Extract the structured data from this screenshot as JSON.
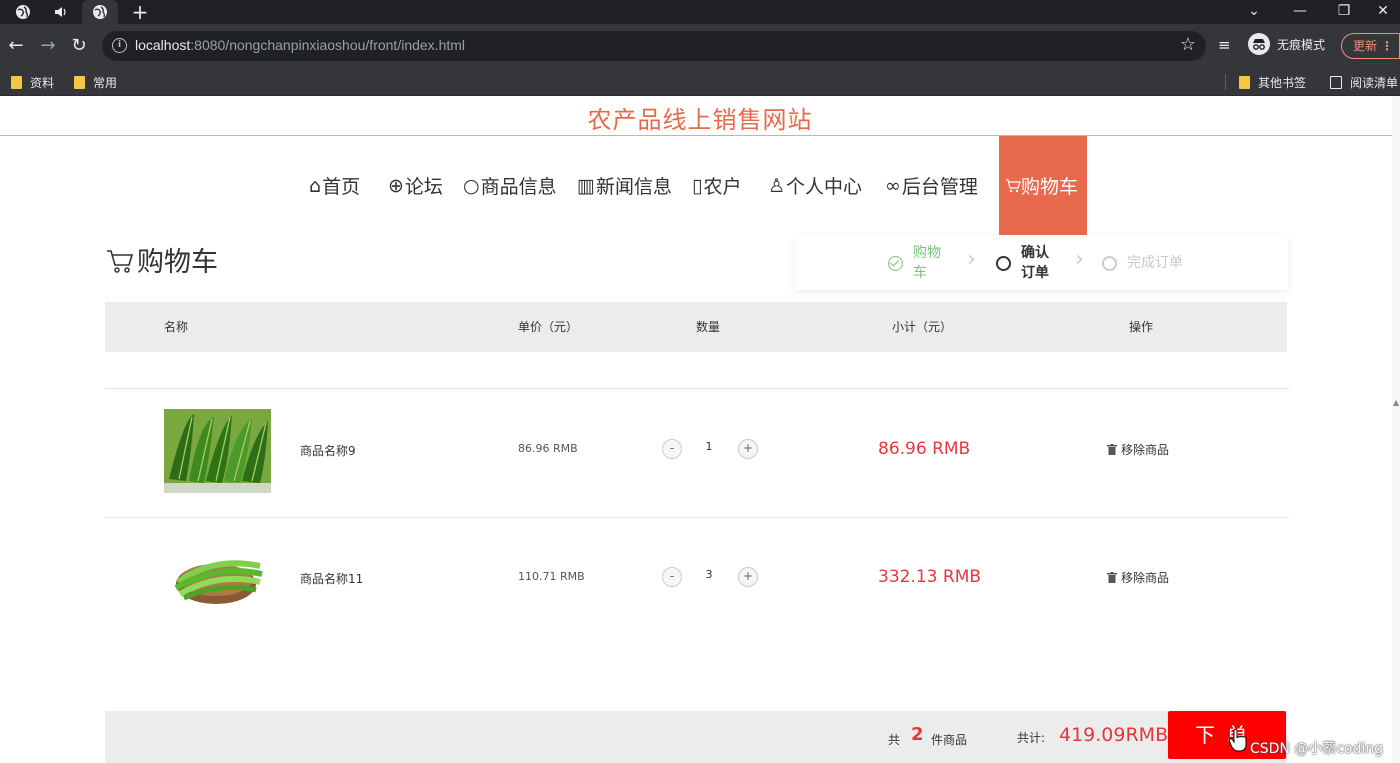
{
  "browser": {
    "new_tab": "+",
    "url_host": "localhost",
    "url_rest": ":8080/nongchanpinxiaoshou/front/index.html",
    "incognito_label": "无痕模式",
    "update_label": "更新",
    "update_dots": "⋮",
    "window_min": "—",
    "window_restore": "❐",
    "window_close": "✕",
    "tab_search": "⌄",
    "bookmarks": [
      "资料",
      "常用"
    ],
    "bookmarks_right": [
      "其他书签",
      "阅读清单"
    ]
  },
  "site": {
    "title": "农产品线上销售网站",
    "menu": [
      {
        "label": "首页",
        "icon": "⌂"
      },
      {
        "label": "论坛",
        "icon": "⊕"
      },
      {
        "label": "商品信息",
        "icon": "○"
      },
      {
        "label": "新闻信息",
        "icon": "▥"
      },
      {
        "label": "农户",
        "icon": "▯"
      },
      {
        "label": "个人中心",
        "icon": "♙"
      },
      {
        "label": "后台管理",
        "icon": "∞"
      },
      {
        "label": "购物车",
        "icon": "🛒"
      }
    ]
  },
  "cart": {
    "heading": "购物车",
    "steps": [
      {
        "label": "购物车",
        "state": "done"
      },
      {
        "label": "确认订单",
        "state": "current"
      },
      {
        "label": "完成订单",
        "state": "pending"
      }
    ],
    "columns": [
      "名称",
      "单价（元）",
      "数量",
      "小计（元）",
      "操作"
    ],
    "items": [
      {
        "name": "商品名称9",
        "unit_price": "86.96 RMB",
        "qty": "1",
        "subtotal": "86.96 RMB",
        "remove": "移除商品",
        "image": "leafy-greens"
      },
      {
        "name": "商品名称11",
        "unit_price": "110.71 RMB",
        "qty": "3",
        "subtotal": "332.13 RMB",
        "remove": "移除商品",
        "image": "green-beans"
      }
    ],
    "minus": "-",
    "plus": "+",
    "footer": {
      "gong": "共",
      "count": "2",
      "count_unit": "件商品",
      "total_label": "共计:",
      "total": "419.09RMB",
      "order_button": "下单"
    }
  },
  "watermark": "CSDN @小蔡coding",
  "colors": {
    "brand": "#e9694c",
    "price": "#e4393c",
    "order_button": "#ff0000",
    "step_done": "#7cc47a"
  }
}
